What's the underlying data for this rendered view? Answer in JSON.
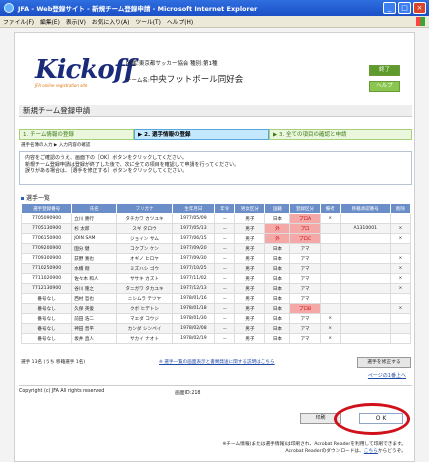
{
  "window": {
    "title": "JFA - Web登録サイト - 新規チーム登録申請 - Microsoft Internet Explorer",
    "menu": [
      "ファイル(F)",
      "編集(E)",
      "表示(V)",
      "お気に入り(A)",
      "ツール(T)",
      "ヘルプ(H)"
    ]
  },
  "header": {
    "logo": "Kickoff",
    "logo_sub": "JFA online registration site",
    "org": "所属:東京都サッカー協会  種別:第1種",
    "team_label": "チーム名:",
    "team_name": "中央フットボール同好会",
    "done_button": "終了",
    "help_button": "ヘルプ"
  },
  "section_title": "新規チーム登録申請",
  "steps": [
    "1. チーム情報の登録",
    "▶ 2. 選手情報の登録",
    "▶ 3. 全ての項目の確認と申請"
  ],
  "step_caption": "選手名簿の入力 ▶ 入力内容の確認",
  "notice": [
    "内容をご確認のうえ、画面下の［OK］ボタンをクリックしてください。",
    "新規チーム登録申請は登録が終了した後で、次に全ての項目を確認して申請を行ってください。",
    "誤りがある場合は、［選手を修正する］ボタンをクリックしてください。"
  ],
  "list_title": "選手一覧",
  "table": {
    "headers": [
      "選手登録番号",
      "氏名",
      "フリガナ",
      "生年月日",
      "年令",
      "男女区分",
      "国籍",
      "登録区分",
      "備考",
      "移籍承認番号",
      "削除"
    ],
    "rows": [
      [
        "7705090900",
        "立川 勝行",
        "タチカワ カツユキ",
        "1977/05/09",
        "－",
        "男子",
        "日本",
        "プロA",
        "×",
        "",
        ""
      ],
      [
        "7705130900",
        "杉 太郎",
        "スギ タロウ",
        "1977/05/13",
        "－",
        "男子",
        "外",
        "プロ",
        "",
        "A1310001",
        "×"
      ],
      [
        "7706150900",
        "JOIN SAM",
        "ジョイン サム",
        "1977/06/15",
        "－",
        "男子",
        "外",
        "プロC",
        "",
        "",
        "×"
      ],
      [
        "7709200900",
        "国分 健",
        "コクブン ケン",
        "1977/09/20",
        "－",
        "男子",
        "日本",
        "アマ",
        "",
        "",
        ""
      ],
      [
        "7709300900",
        "荻野 寛也",
        "オギノ ヒロヤ",
        "1977/09/30",
        "－",
        "男子",
        "日本",
        "アマ",
        "",
        "",
        "×"
      ],
      [
        "7710250900",
        "水橋 剛",
        "ミズハシ ゴウ",
        "1977/10/25",
        "－",
        "男子",
        "日本",
        "アマ",
        "",
        "",
        "×"
      ],
      [
        "7711020900",
        "佐々木 和人",
        "ササキ カズト",
        "1977/11/02",
        "－",
        "男子",
        "日本",
        "アマ",
        "",
        "",
        "×"
      ],
      [
        "7712130900",
        "谷川 隆之",
        "タニガワ タカユキ",
        "1977/12/13",
        "－",
        "男子",
        "日本",
        "アマ",
        "",
        "",
        "×"
      ],
      [
        "番号なし",
        "西村 哲也",
        "ニシムラ テツヤ",
        "1978/01/16",
        "－",
        "男子",
        "日本",
        "アマ",
        "",
        "",
        ""
      ],
      [
        "番号なし",
        "久保 英俊",
        "クボ ヒデトシ",
        "1978/01/18",
        "－",
        "男子",
        "日本",
        "プロB",
        "",
        "",
        "×"
      ],
      [
        "番号なし",
        "前田 浩二",
        "マエダ コウジ",
        "1978/01/30",
        "－",
        "男子",
        "日本",
        "アマ",
        "×",
        "",
        ""
      ],
      [
        "番号なし",
        "神田 晋平",
        "カンダ シンペイ",
        "1978/02/08",
        "－",
        "男子",
        "日本",
        "アマ",
        "×",
        "",
        ""
      ],
      [
        "番号なし",
        "坂井 直人",
        "サカイ ナオト",
        "1978/02/19",
        "－",
        "男子",
        "日本",
        "アマ",
        "×",
        "",
        ""
      ]
    ]
  },
  "footer": {
    "stat": "選手 13名 (うち 移籍選手 1名)",
    "note": "※ 選手一覧の画面表示と書類発送に関する説明はこちら",
    "fix_button": "選手を修正する",
    "pager": "ページの1番上へ",
    "copyright": "Copyright (c) JFA All rights reserved",
    "screen_id": "画面ID:218",
    "print_button": "印刷",
    "ok_button": "O K",
    "bottom_note_1": "※チーム情報(または選手情報)は印刷され、Acrobat Readerを利用して印刷できます。",
    "bottom_note_2": "Acrobat Readerのダウンロードは、",
    "bottom_note_link": "こちら",
    "bottom_note_3": "からどうぞ。"
  }
}
